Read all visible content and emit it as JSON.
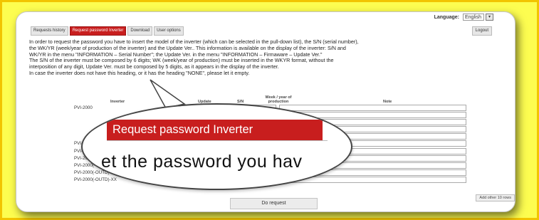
{
  "header": {
    "language_label": "Language:",
    "language_value": "English",
    "dropdown_glyph": "▾",
    "logout_label": "Logout"
  },
  "tabs": [
    {
      "label": "Requests history",
      "active": false
    },
    {
      "label": "Request password Inverter",
      "active": true
    },
    {
      "label": "Download",
      "active": false
    },
    {
      "label": "User options",
      "active": false
    }
  ],
  "instructions": [
    "In order to request the password you have to insert the model of the inverter (which can be selected in the pull-down list), the S/N (serial number),",
    "the WK/YR (week/year of production of the inverter) and the Update Ver.. This information is available on the display of the inverter: S/N and",
    "WK/YR in the menu \"INFORMATION – Serial Number\"; the Update Ver. in the menu \"INFORMATION – Firmaware – Update Ver.\"",
    "The S/N of the inverter must be composed by 6 digits; WK (week/year of production) must be inserted in the WKYR format, without the",
    "interposition of any digit, Update Ver. must be composed by 5 digits, as it appears in the display of the inverter.",
    "In case the inverter does not have this heading, or it has the heading \"NONE\", please let it empty."
  ],
  "table": {
    "columns": {
      "model": "Inverter",
      "update": "Update",
      "sn": "S/N",
      "week": "Week / year of production",
      "note": "Note"
    },
    "rows": [
      {
        "model": "PVI-2000"
      },
      {
        "model": ""
      },
      {
        "model": ""
      },
      {
        "model": ""
      },
      {
        "model": ""
      },
      {
        "model": "PVI-2000"
      },
      {
        "model": "PVI-2000(-OUTD)"
      },
      {
        "model": "PVI-2000(-OUTD)-XX"
      },
      {
        "model": "PVI-2000(-OUTD)-XX"
      },
      {
        "model": "PVI-2000(-OUTD)-XX"
      },
      {
        "model": "PVI-2000(-OUTD)-XX"
      }
    ],
    "add_rows_label": "Add other 10 rows"
  },
  "submit_label": "Do request",
  "zoom": {
    "tab_label": "Request password Inverter",
    "text": "et the password you hav"
  },
  "colors": {
    "accent": "#c81e1e",
    "frame": "#fdfd50"
  }
}
